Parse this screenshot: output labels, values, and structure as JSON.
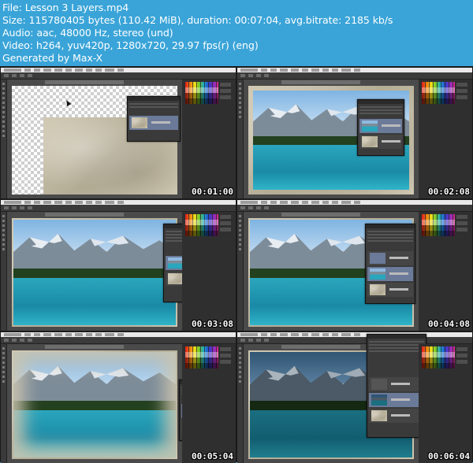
{
  "header": {
    "lines": [
      "File: Lesson 3 Layers.mp4",
      "Size: 115780405 bytes (110.42 MiB), duration: 00:07:04, avg.bitrate: 2185 kb/s",
      "Audio: aac, 48000 Hz, stereo (und)",
      "Video: h264, yuv420p, 1280x720, 29.97 fps(r) (eng)",
      "Generated by Max-X"
    ]
  },
  "thumbnails": [
    {
      "timestamp": "00:01:00",
      "scene": "texture-on-transparent"
    },
    {
      "timestamp": "00:02:08",
      "scene": "lake-photo"
    },
    {
      "timestamp": "00:03:08",
      "scene": "lake-photo"
    },
    {
      "timestamp": "00:04:08",
      "scene": "lake-photo"
    },
    {
      "timestamp": "00:05:04",
      "scene": "lake-photo-masked"
    },
    {
      "timestamp": "00:06:04",
      "scene": "lake-photo-dark"
    }
  ],
  "colors": {
    "header_bg": "#3aa4d8",
    "header_text": "#ffffff",
    "photoshop_ui": "#2c2c2c",
    "selected_layer": "#6b7a99"
  }
}
